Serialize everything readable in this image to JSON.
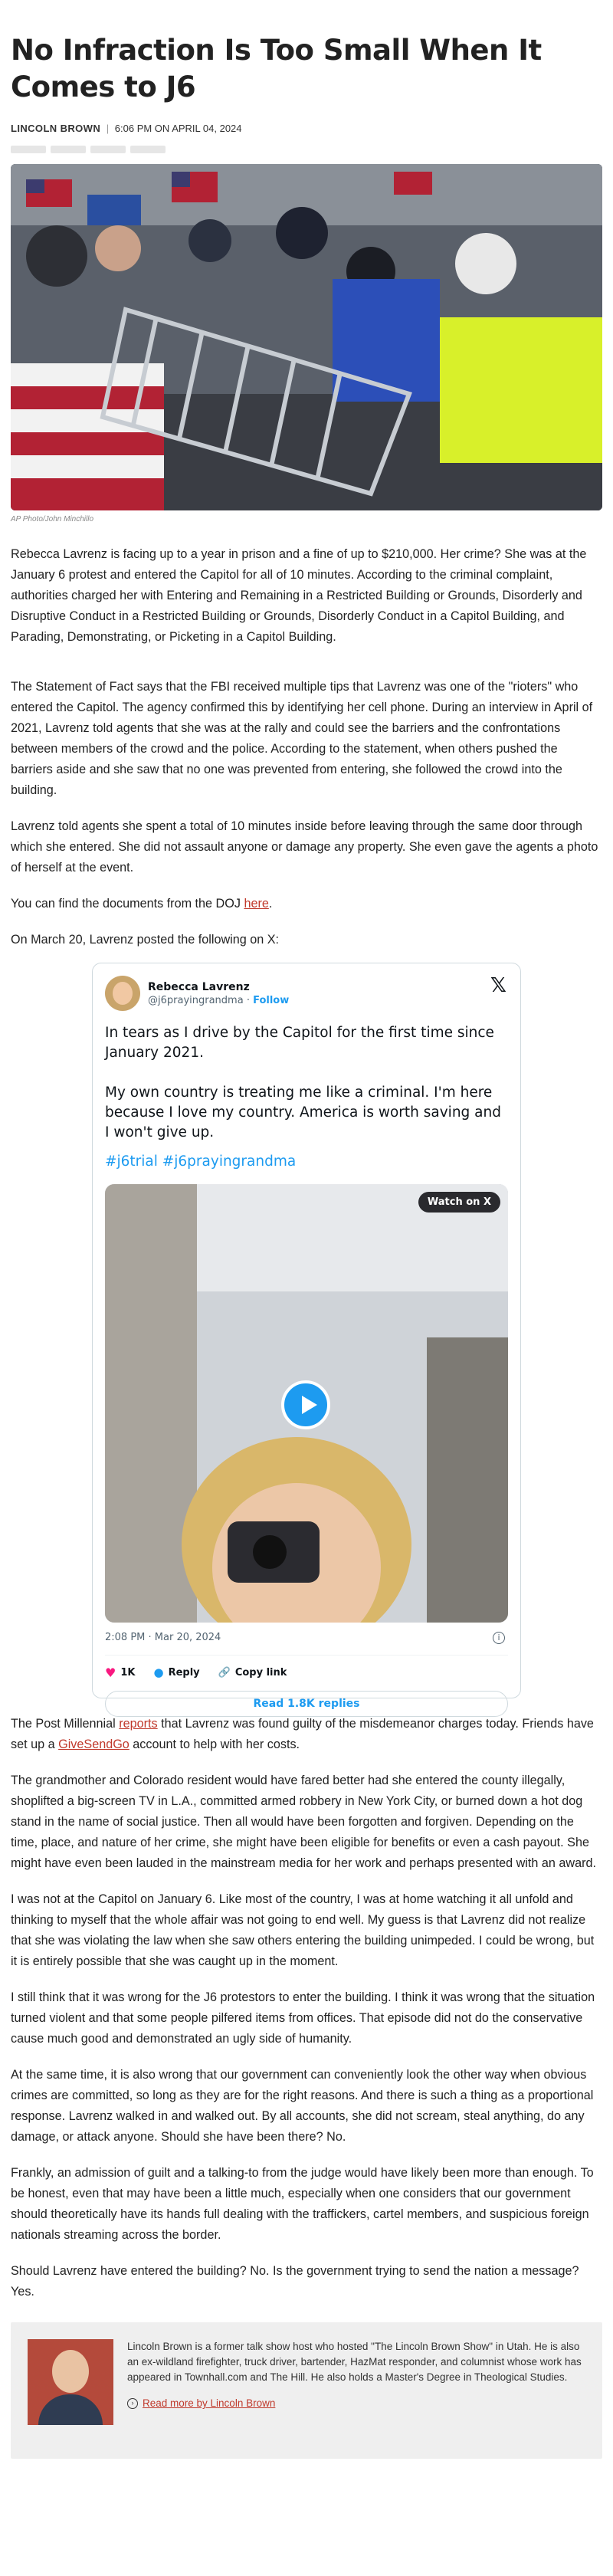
{
  "article": {
    "title": "No Infraction Is Too Small When It Comes to J6",
    "author": "LINCOLN BROWN",
    "separator": "|",
    "date": "6:06 PM ON APRIL 04, 2024",
    "image_caption": "AP Photo/John Minchillo"
  },
  "paragraphs": {
    "p1": "Rebecca Lavrenz is facing up to a year in prison and a fine of up to $210,000. Her crime? She was at the January 6 protest and entered the Capitol for all of 10 minutes. According to the criminal complaint, authorities charged her with Entering and Remaining in a Restricted Building or Grounds, Disorderly and Disruptive Conduct in a Restricted Building or Grounds, Disorderly Conduct in a Capitol Building, and Parading, Demonstrating, or Picketing in a Capitol Building.",
    "p2": "The Statement of Fact says that the FBI received multiple tips that Lavrenz was one of the \"rioters\" who entered the Capitol. The agency confirmed this by identifying her cell phone. During an interview in April of 2021, Lavrenz told agents that she was at the rally and could see the barriers and the confrontations between members of the crowd and the police. According to the statement, when others pushed the barriers aside and she saw that no one was prevented from entering, she followed the crowd into the building.",
    "p3": "Lavrenz told agents she spent a total of 10 minutes inside before leaving through the same door through which she entered. She did not assault anyone or damage any property. She even gave the agents a photo of herself at the event.",
    "p4_pre": "You can find the documents from the DOJ ",
    "p4_link": "here",
    "p4_post": ".",
    "p5": "On March 20, Lavrenz posted the following on X:",
    "p6_pre": "The Post Millennial ",
    "p6_link": "reports",
    "p6_mid": " that Lavrenz was found guilty of the misdemeanor charges today. Friends have set up a ",
    "p6_link2": "GiveSendGo",
    "p6_post": " account to help with her costs.",
    "p7": "The grandmother and Colorado resident would have fared better had she entered the county illegally, shoplifted a big-screen TV in L.A., committed armed robbery in New York City, or burned down a hot dog stand in the name of social justice. Then all would have been forgotten and forgiven. Depending on the time, place, and nature of her crime, she might have been eligible for benefits or even a cash payout. She might have even been lauded in the mainstream media for her work and perhaps presented with an award.",
    "p8": "I was not at the Capitol on January 6. Like most of the country, I was at home watching it all unfold and thinking to myself that the whole affair was not going to end well. My guess is that Lavrenz did not realize that she was violating the law when she saw others entering the building unimpeded. I could be wrong, but it is entirely possible that she was caught up in the moment.",
    "p9": "I still think that it was wrong for the J6 protestors to enter the building. I think it was wrong that the situation turned violent and that some people pilfered items from offices. That episode did not do the conservative cause much good and demonstrated an ugly side of humanity.",
    "p10": "At the same time, it is also wrong that our government can conveniently look the other way when obvious crimes are committed, so long as they are for the right reasons. And there is such a thing as a proportional response. Lavrenz walked in and walked out. By all accounts, she did not scream, steal anything, do any damage, or attack anyone. Should she have been there? No.",
    "p11": "Frankly, an admission of guilt and a talking-to from the judge would have likely been more than enough. To be honest, even that may have been a little much, especially when one considers that our government should theoretically have its hands full dealing with the traffickers, cartel members, and suspicious foreign nationals streaming across the border.",
    "p12": "Should Lavrenz have entered the building? No. Is the government trying to send the nation a message? Yes."
  },
  "tweet": {
    "name": "Rebecca Lavrenz",
    "handle": "@j6prayingrandma",
    "dot": " · ",
    "follow": "Follow",
    "x_logo": "𝕏",
    "text": "In tears as I drive by the Capitol for the first time since January 2021.\n\nMy own country is treating me like a criminal. I'm here because I love my country. America is worth saving and I won't give up.",
    "hashtags": "#j6trial #j6prayingrandma",
    "watch_label": "Watch on X",
    "timestamp": "2:08 PM · Mar 20, 2024",
    "likes": "1K",
    "reply_label": "Reply",
    "copy_link_label": "Copy link",
    "replies_button": "Read 1.8K replies"
  },
  "bio": {
    "text": "Lincoln Brown is a former talk show host who hosted \"The Lincoln Brown Show\" in Utah. He is also an ex-wildland firefighter, truck driver, bartender, HazMat responder, and columnist whose work has appeared in Townhall.com and The Hill. He also holds a Master's Degree in Theological Studies.",
    "more_link": "Read more by Lincoln Brown"
  },
  "colors": {
    "link": "#c0392b",
    "x_blue": "#1d9bf0",
    "heart": "#f91880"
  },
  "icons": [
    "x-logo-icon",
    "play-icon",
    "heart-icon",
    "reply-icon",
    "link-icon",
    "info-icon",
    "arrow-circle-icon"
  ]
}
